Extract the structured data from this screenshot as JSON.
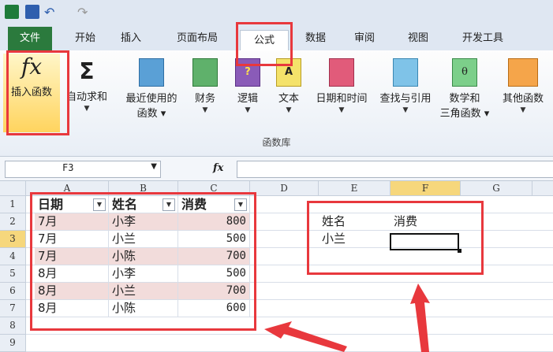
{
  "tabs": [
    "文件",
    "开始",
    "插入",
    "页面布局",
    "公式",
    "数据",
    "审阅",
    "视图",
    "开发工具"
  ],
  "ribbon": {
    "insert_function": "插入函数",
    "autosum": "自动求和",
    "recent_1": "最近使用的",
    "recent_2": "函数",
    "financial": "财务",
    "logical": "逻辑",
    "text": "文本",
    "datetime": "日期和时间",
    "lookup": "查找与引用",
    "math_1": "数学和",
    "math_2": "三角函数",
    "other": "其他函数",
    "group_label": "函数库"
  },
  "formula_bar": {
    "name_box": "F3",
    "fx": "fx"
  },
  "columns": [
    "A",
    "B",
    "C",
    "D",
    "E",
    "F",
    "G"
  ],
  "rows": [
    "1",
    "2",
    "3",
    "4",
    "5",
    "6",
    "7",
    "8",
    "9"
  ],
  "table": {
    "headers": [
      "日期",
      "姓名",
      "消费"
    ],
    "rows": [
      [
        "7月",
        "小李",
        "800"
      ],
      [
        "7月",
        "小兰",
        "500"
      ],
      [
        "7月",
        "小陈",
        "700"
      ],
      [
        "8月",
        "小李",
        "500"
      ],
      [
        "8月",
        "小兰",
        "700"
      ],
      [
        "8月",
        "小陈",
        "600"
      ]
    ]
  },
  "lookup": {
    "label_name": "姓名",
    "label_cost": "消费",
    "value_name": "小兰"
  }
}
